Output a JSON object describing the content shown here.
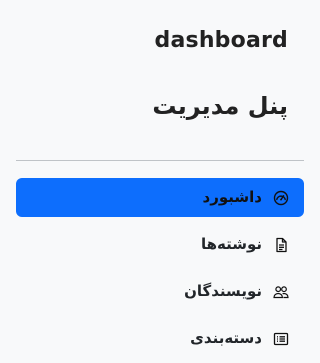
{
  "brand": {
    "english_title": "dashboard",
    "panel_title": "پنل مدیریت"
  },
  "nav": {
    "items": [
      {
        "label": "داشبورد",
        "icon": "speedometer-icon",
        "active": true
      },
      {
        "label": "نوشته‌ها",
        "icon": "document-icon",
        "active": false
      },
      {
        "label": "نویسندگان",
        "icon": "people-icon",
        "active": false
      },
      {
        "label": "دسته‌بندی",
        "icon": "list-icon",
        "active": false
      }
    ]
  },
  "colors": {
    "background": "#f8f9fa",
    "active_item": "#0d6efd",
    "divider": "#bfc3c7",
    "text": "#212529"
  }
}
